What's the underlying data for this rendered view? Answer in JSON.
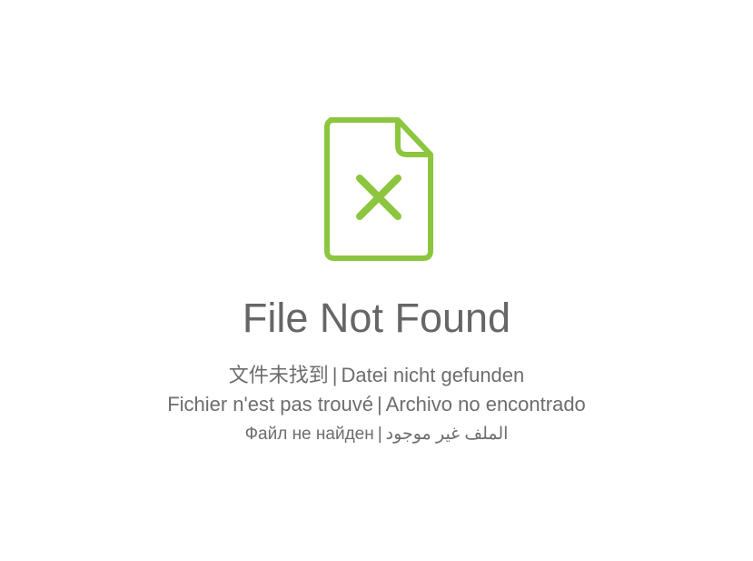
{
  "icon": {
    "name": "file-not-found-icon",
    "color": "#8cc63f"
  },
  "title": "File Not Found",
  "translations": {
    "zh": "文件未找到",
    "de": "Datei nicht gefunden",
    "fr": "Fichier n'est pas trouvé",
    "es": "Archivo no encontrado",
    "ru": "Файл не найден",
    "ar": "الملف غير موجود",
    "separator": "|"
  },
  "colors": {
    "text": "#666666",
    "accent": "#8cc63f",
    "background": "#ffffff"
  }
}
